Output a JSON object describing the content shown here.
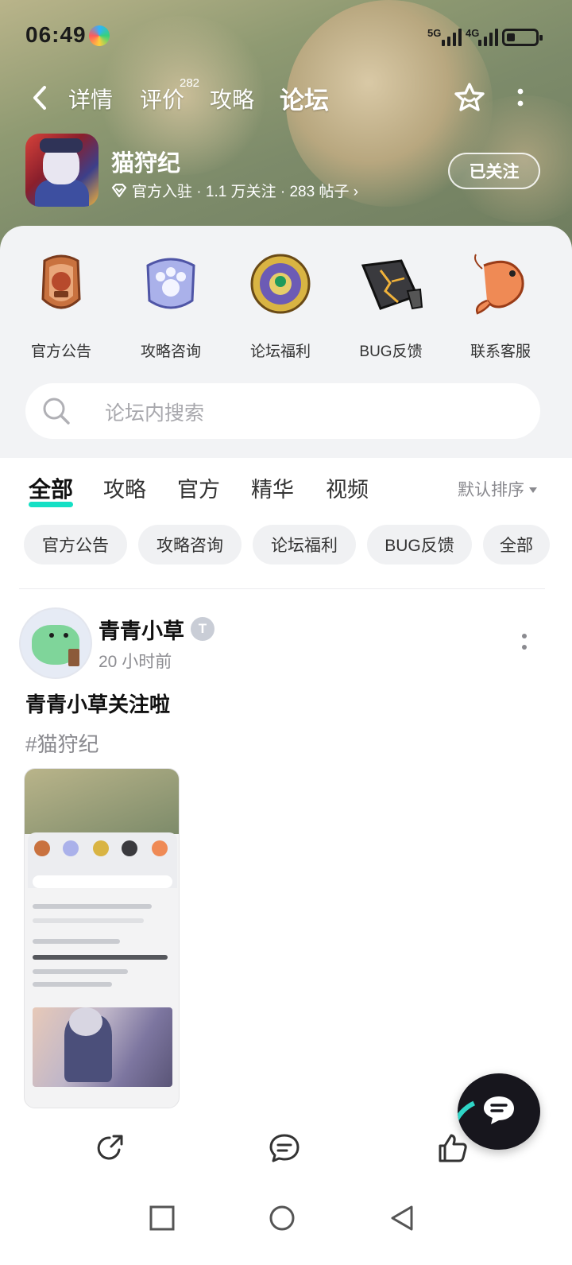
{
  "status_bar": {
    "time": "06:49",
    "signal1_label": "5G",
    "signal2_label": "4G"
  },
  "nav": {
    "tabs": [
      {
        "label": "详情"
      },
      {
        "label": "评价",
        "badge": "282"
      },
      {
        "label": "攻略"
      },
      {
        "label": "论坛"
      }
    ],
    "active_tab": "论坛"
  },
  "game": {
    "name": "猫狩纪",
    "meta": "官方入驻 · 1.1 万关注 · 283 帖子 ›",
    "follow_label": "已关注"
  },
  "quick_entries": [
    {
      "label": "官方公告",
      "icon": "official-badge-icon"
    },
    {
      "label": "攻略咨询",
      "icon": "paw-shield-icon"
    },
    {
      "label": "论坛福利",
      "icon": "emerald-medal-icon"
    },
    {
      "label": "BUG反馈",
      "icon": "cracked-stone-icon"
    },
    {
      "label": "联系客服",
      "icon": "koi-fish-icon"
    }
  ],
  "search": {
    "placeholder": "论坛内搜索"
  },
  "feed_tabs": [
    {
      "label": "全部"
    },
    {
      "label": "攻略"
    },
    {
      "label": "官方"
    },
    {
      "label": "精华"
    },
    {
      "label": "视频"
    }
  ],
  "active_feed_tab": "全部",
  "sort_label": "默认排序",
  "chips": [
    {
      "label": "官方公告"
    },
    {
      "label": "攻略咨询"
    },
    {
      "label": "论坛福利"
    },
    {
      "label": "BUG反馈"
    },
    {
      "label": "全部"
    }
  ],
  "post": {
    "author": "青青小草",
    "author_badge": "T",
    "time": "20 小时前",
    "title": "青青小草关注啦",
    "tag": "#猫狩纪"
  },
  "colors": {
    "accent": "#15e0c5",
    "sheet_bg": "#f2f3f5",
    "chip_bg": "#f0f1f3",
    "fab_bg": "#17161d"
  }
}
